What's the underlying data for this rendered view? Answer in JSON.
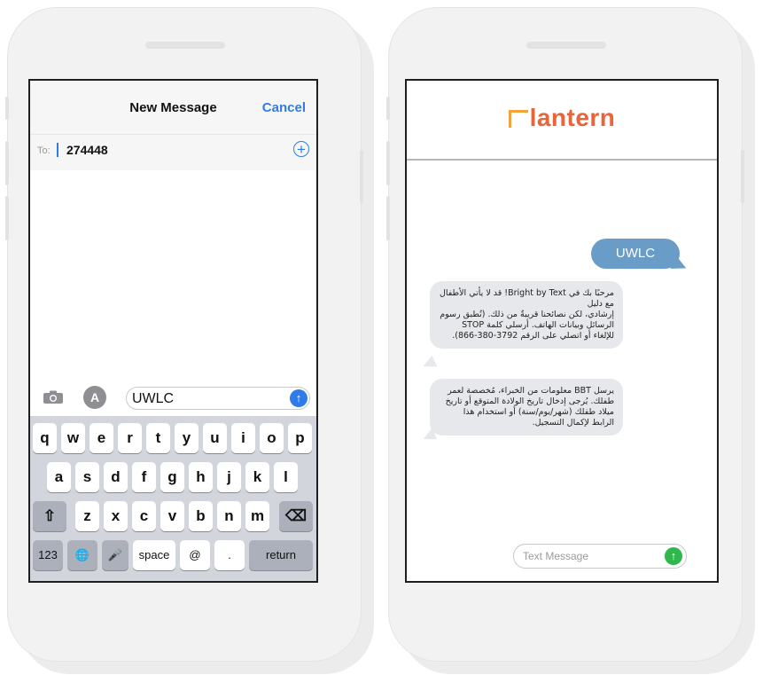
{
  "left_phone": {
    "nav": {
      "title": "New Message",
      "cancel": "Cancel"
    },
    "to": {
      "label": "To:",
      "value": "274448",
      "add": "+"
    },
    "input": {
      "value": "UWLC",
      "send": "↑",
      "store_glyph": "A"
    },
    "keyboard": {
      "row1": [
        "q",
        "w",
        "e",
        "r",
        "t",
        "y",
        "u",
        "i",
        "o",
        "p"
      ],
      "row2": [
        "a",
        "s",
        "d",
        "f",
        "g",
        "h",
        "j",
        "k",
        "l"
      ],
      "row3": [
        "z",
        "x",
        "c",
        "v",
        "b",
        "n",
        "m"
      ],
      "shift": "⇧",
      "delete": "⌫",
      "numbers": "123",
      "globe": "🌐",
      "mic": "🎤",
      "space": "space",
      "at": "@",
      "dot": ".",
      "return": "return"
    }
  },
  "right_phone": {
    "logo_text": "lantern",
    "sent_message": "UWLC",
    "received": [
      {
        "lines": [
          "مرحبًا بك في Bright by Text! قد لا يأتي الأطفال مع دليل",
          "إرشادي، لكن نصائحنا قريبةٌ من ذلك. (تُطبق رسوم الرسائل وبيانات الهاتف. أرسلي كلمة STOP للإلغاء أو اتصلي على الرقم 3792-380-866)."
        ]
      },
      {
        "lines": [
          "يرسل BBT معلومات من الخبراء، مُخصصة لعمر طفلك. يُرجى إدخال تاريخ الولادة المتوقع أو تاريخ ميلاد طفلك (شهر/يوم/سنة) أو استخدام هذا الرابط لإكمال التسجيل."
        ]
      }
    ],
    "composer": {
      "placeholder": "Text Message",
      "send": "↑"
    }
  },
  "colors": {
    "ios_blue": "#2f7ce8",
    "sent_bubble": "#6a9cc8",
    "received_bubble": "#e6e8eb",
    "logo_orange": "#e8643a",
    "send_green": "#2eb84c"
  }
}
